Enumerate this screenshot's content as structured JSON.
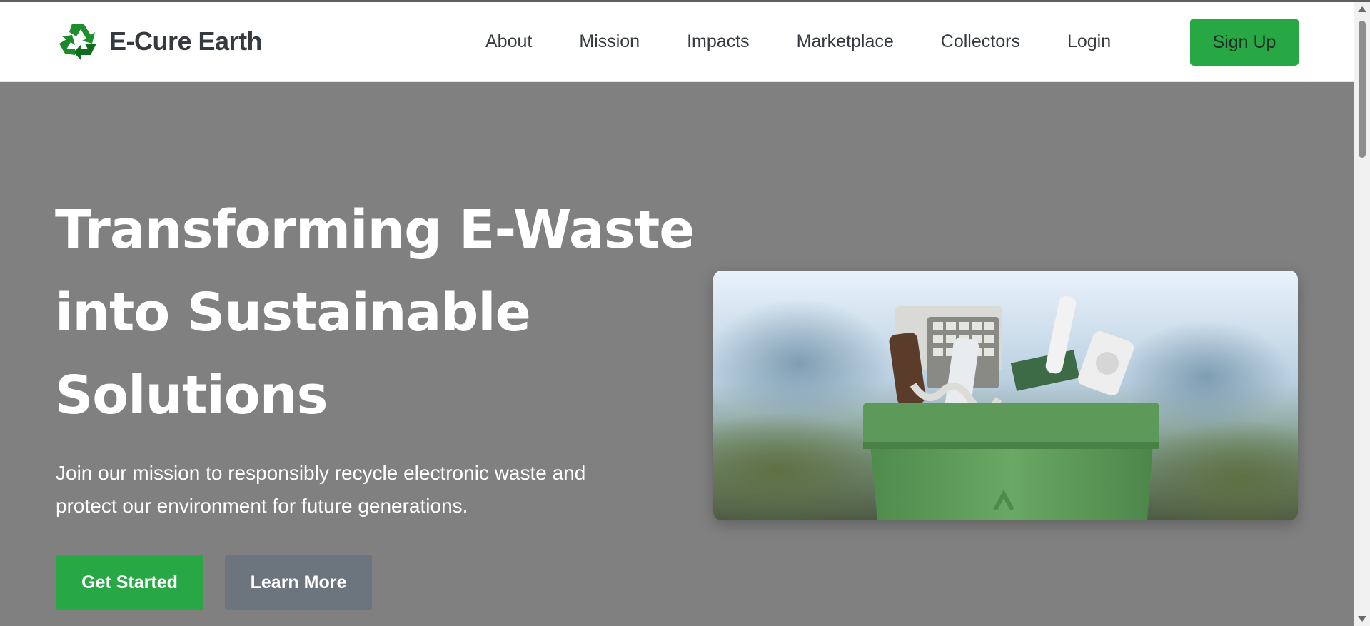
{
  "header": {
    "brand_name": "E-Cure Earth",
    "brand_icon": "recycle-icon",
    "nav": [
      {
        "label": "About"
      },
      {
        "label": "Mission"
      },
      {
        "label": "Impacts"
      },
      {
        "label": "Marketplace"
      },
      {
        "label": "Collectors"
      },
      {
        "label": "Login"
      }
    ],
    "signup_label": "Sign Up"
  },
  "hero": {
    "title_lines": [
      "Transforming E-Waste",
      "into Sustainable",
      "Solutions"
    ],
    "subtitle_lines": [
      "Join our mission to responsibly recycle electronic waste and",
      "protect our environment for future generations."
    ],
    "primary_button": "Get Started",
    "secondary_button": "Learn More",
    "image_subject": "green-recycling-bin-with-electronics-image"
  },
  "colors": {
    "accent": "#28a745",
    "secondary": "#6c757d",
    "hero_background": "#808080",
    "header_text": "#343a40"
  }
}
